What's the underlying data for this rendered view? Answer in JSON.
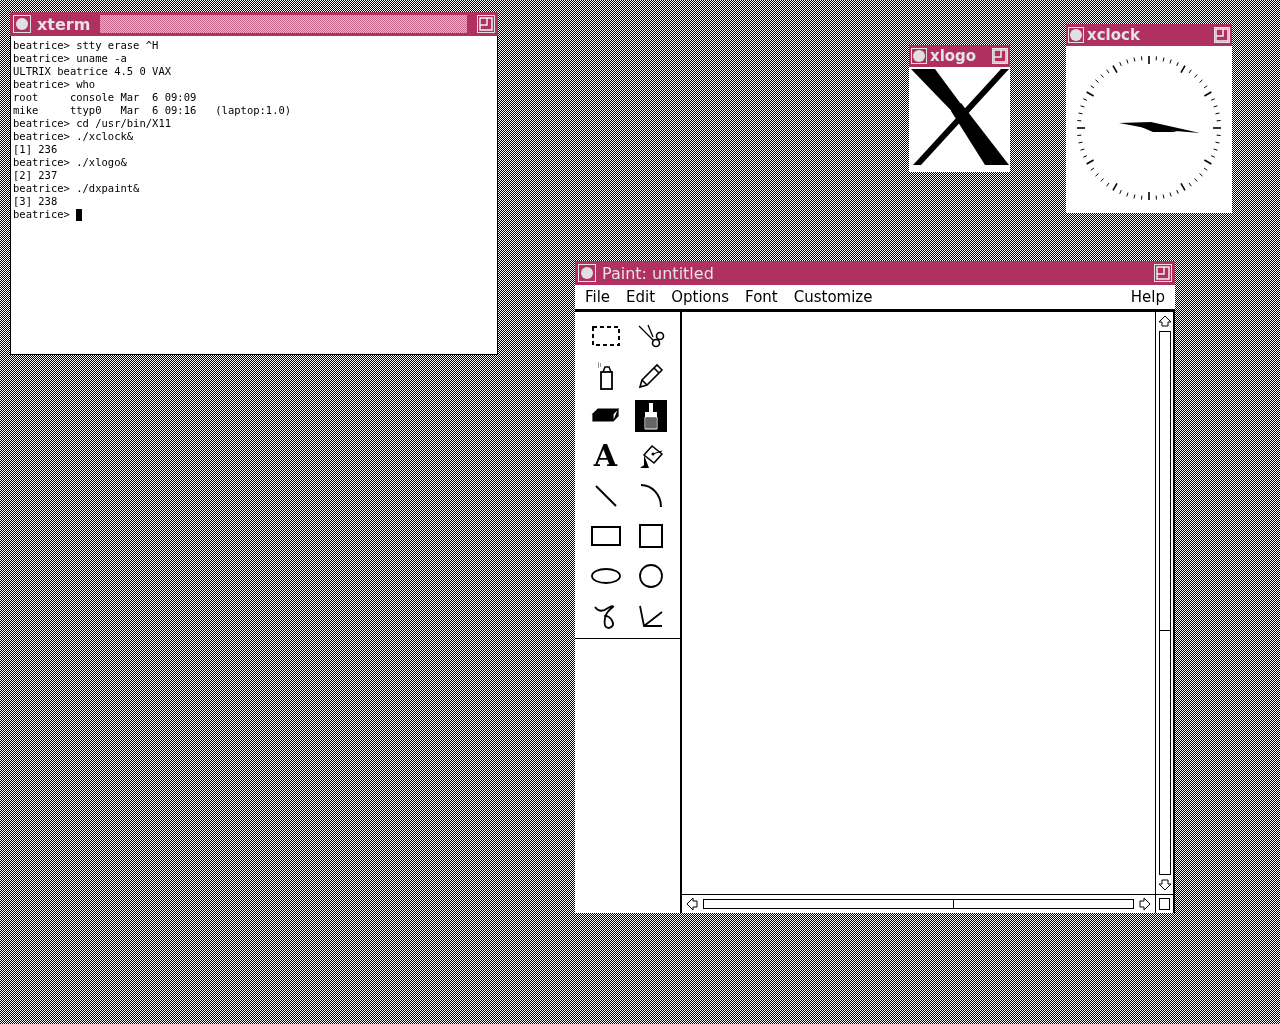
{
  "xterm": {
    "title": "xterm",
    "focused": true,
    "lines": [
      "beatrice> stty erase ^H",
      "beatrice> uname -a",
      "ULTRIX beatrice 4.5 0 VAX",
      "beatrice> who",
      "root     console Mar  6 09:09",
      "mike     ttyp0   Mar  6 09:16   (laptop:1.0)",
      "beatrice> cd /usr/bin/X11",
      "beatrice> ./xclock&",
      "[1] 236",
      "beatrice> ./xlogo&",
      "[2] 237",
      "beatrice> ./dxpaint&",
      "[3] 238"
    ],
    "prompt": "beatrice> "
  },
  "xlogo": {
    "title": "xlogo",
    "focused": false
  },
  "xclock": {
    "title": "xclock",
    "focused": false
  },
  "paint": {
    "title": "Paint: untitled",
    "focused": false,
    "menu": [
      {
        "label": "File"
      },
      {
        "label": "Edit"
      },
      {
        "label": "Options"
      },
      {
        "label": "Font"
      },
      {
        "label": "Customize"
      }
    ],
    "help": "Help",
    "tools": [
      {
        "kind": "select",
        "selected": false
      },
      {
        "kind": "scissors",
        "selected": false
      },
      {
        "kind": "spray",
        "selected": false
      },
      {
        "kind": "pencil",
        "selected": false
      },
      {
        "kind": "eraser",
        "selected": false
      },
      {
        "kind": "brush",
        "selected": true
      },
      {
        "kind": "text",
        "glyph": "A",
        "selected": false
      },
      {
        "kind": "fill",
        "selected": false
      },
      {
        "kind": "line",
        "selected": false
      },
      {
        "kind": "arc",
        "selected": false
      },
      {
        "kind": "rect",
        "selected": false
      },
      {
        "kind": "square",
        "selected": false
      },
      {
        "kind": "ellipse",
        "selected": false
      },
      {
        "kind": "circle",
        "selected": false
      },
      {
        "kind": "curve",
        "selected": false
      },
      {
        "kind": "polyline",
        "selected": false
      }
    ]
  }
}
